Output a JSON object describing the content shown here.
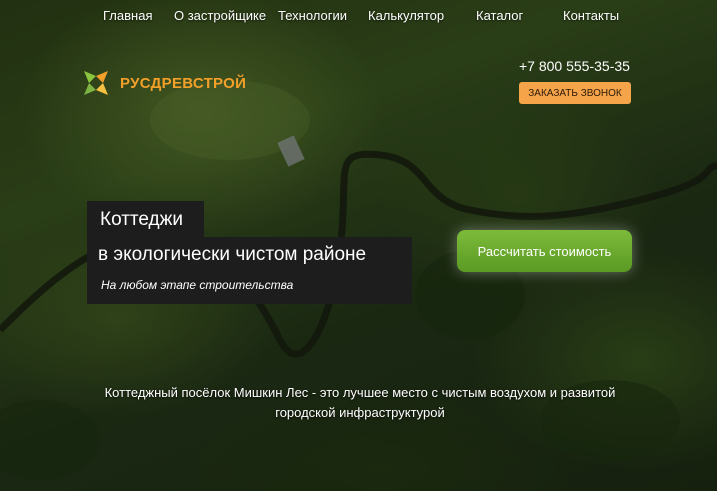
{
  "nav": {
    "items": [
      "Главная",
      "О застройщике",
      "Технологии",
      "Калькулятор",
      "Каталог",
      "Контакты"
    ]
  },
  "brand": {
    "name": "РУСДРЕВСТРОЙ",
    "colors": [
      "#f2a02a",
      "#8cc63f",
      "#f6c142"
    ]
  },
  "header": {
    "phone": "+7 800 555-35-35",
    "callback_label": "ЗАКАЗАТЬ ЗВОНОК"
  },
  "hero": {
    "line1": "Коттеджи",
    "line2": "в экологически чистом районе",
    "subtitle": "На любом этапе строительства",
    "cta_label": "Рассчитать стоимость"
  },
  "description": "Коттеджный посёлок Мишкин Лес - это лучшее место с чистым воздухом и развитой городской инфраструктурой",
  "theme": {
    "accent_orange": "#f6a44a",
    "cta_green": "#6aab2e",
    "hero_box": "#1d1d1d"
  }
}
